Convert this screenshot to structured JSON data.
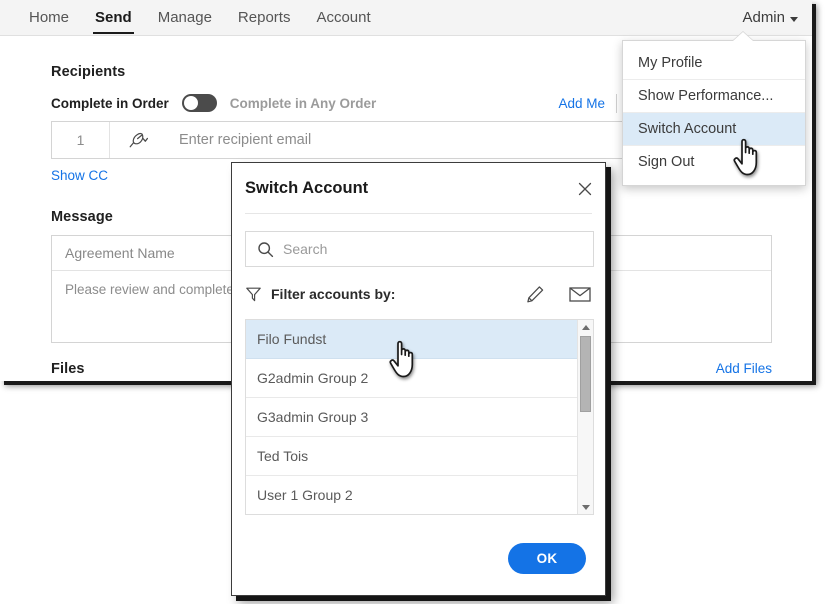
{
  "colors": {
    "accent_blue": "#1473e6",
    "highlight_blue": "#dbeaf7",
    "header_bg": "#f4f4f4",
    "text_dark": "#1b1b1b",
    "text_muted": "#8c8c8c"
  },
  "topnav": {
    "items": [
      {
        "label": "Home",
        "active": false
      },
      {
        "label": "Send",
        "active": true
      },
      {
        "label": "Manage",
        "active": false
      },
      {
        "label": "Reports",
        "active": false
      },
      {
        "label": "Account",
        "active": false
      }
    ],
    "account_menu_label": "Admin"
  },
  "admin_dropdown": {
    "items": [
      {
        "label": "My Profile",
        "highlighted": false
      },
      {
        "label": "Show Performance...",
        "highlighted": false
      },
      {
        "label": "Switch Account",
        "highlighted": true
      },
      {
        "label": "Sign Out",
        "highlighted": false
      }
    ]
  },
  "recipients": {
    "title": "Recipients",
    "complete_in_order_label": "Complete in Order",
    "complete_in_any_order_label": "Complete in Any Order",
    "toggle_state": "off",
    "add_me_label": "Add Me",
    "row": {
      "index": "1",
      "email_placeholder": "Enter recipient email",
      "role_icon": "signature-pen-icon"
    },
    "show_cc_label": "Show CC"
  },
  "message": {
    "title": "Message",
    "agreement_name_placeholder": "Agreement Name",
    "body_placeholder": "Please review and complete t"
  },
  "files": {
    "title": "Files",
    "add_files_label": "Add Files"
  },
  "switch_account_modal": {
    "title": "Switch Account",
    "close_label": "×",
    "search": {
      "placeholder": "Search",
      "value": "",
      "icon": "search-icon"
    },
    "filter": {
      "label": "Filter accounts by:",
      "funnel_icon": "funnel-icon",
      "actions": [
        {
          "icon": "pencil-icon",
          "name": "filter-by-name"
        },
        {
          "icon": "envelope-icon",
          "name": "filter-by-email"
        }
      ]
    },
    "accounts": [
      {
        "label": "Filo Fundst",
        "selected": true
      },
      {
        "label": "G2admin Group 2",
        "selected": false
      },
      {
        "label": "G3admin Group 3",
        "selected": false
      },
      {
        "label": "Ted Tois",
        "selected": false
      },
      {
        "label": "User 1 Group 2",
        "selected": false
      }
    ],
    "ok_label": "OK"
  }
}
